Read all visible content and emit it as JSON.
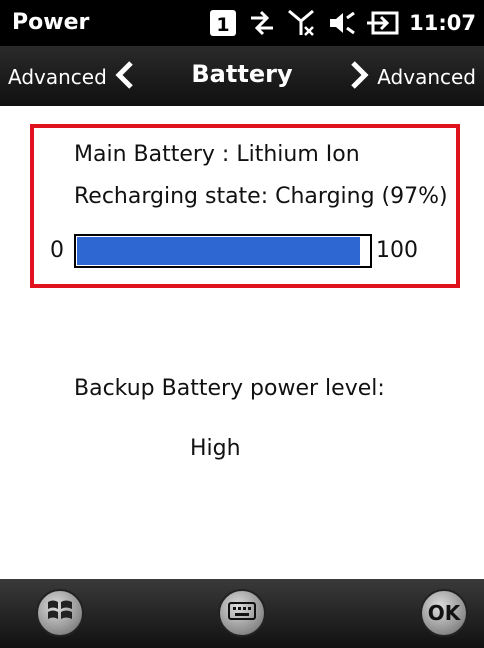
{
  "status_bar": {
    "title": "Power",
    "sim_badge": "1",
    "time": "11:07",
    "icons": [
      "sim-icon",
      "data-arrows-icon",
      "no-signal-icon",
      "volume-icon",
      "battery-charging-icon"
    ]
  },
  "nav": {
    "left_label": "Advanced",
    "title": "Battery",
    "right_label": "Advanced"
  },
  "main_battery": {
    "type_line": "Main Battery : Lithium Ion",
    "state_line": "Recharging state:  Charging (97%)",
    "bar_min": "0",
    "bar_max": "100",
    "level": 0.97
  },
  "backup_battery": {
    "label": "Backup Battery power level:",
    "value": "High"
  },
  "bottom_bar": {
    "ok_label": "OK",
    "icons": [
      "windows-start-icon",
      "keyboard-icon",
      "ok-icon"
    ]
  },
  "colors": {
    "highlight_border": "#e0121d",
    "bar_fill": "#2e67d1"
  }
}
